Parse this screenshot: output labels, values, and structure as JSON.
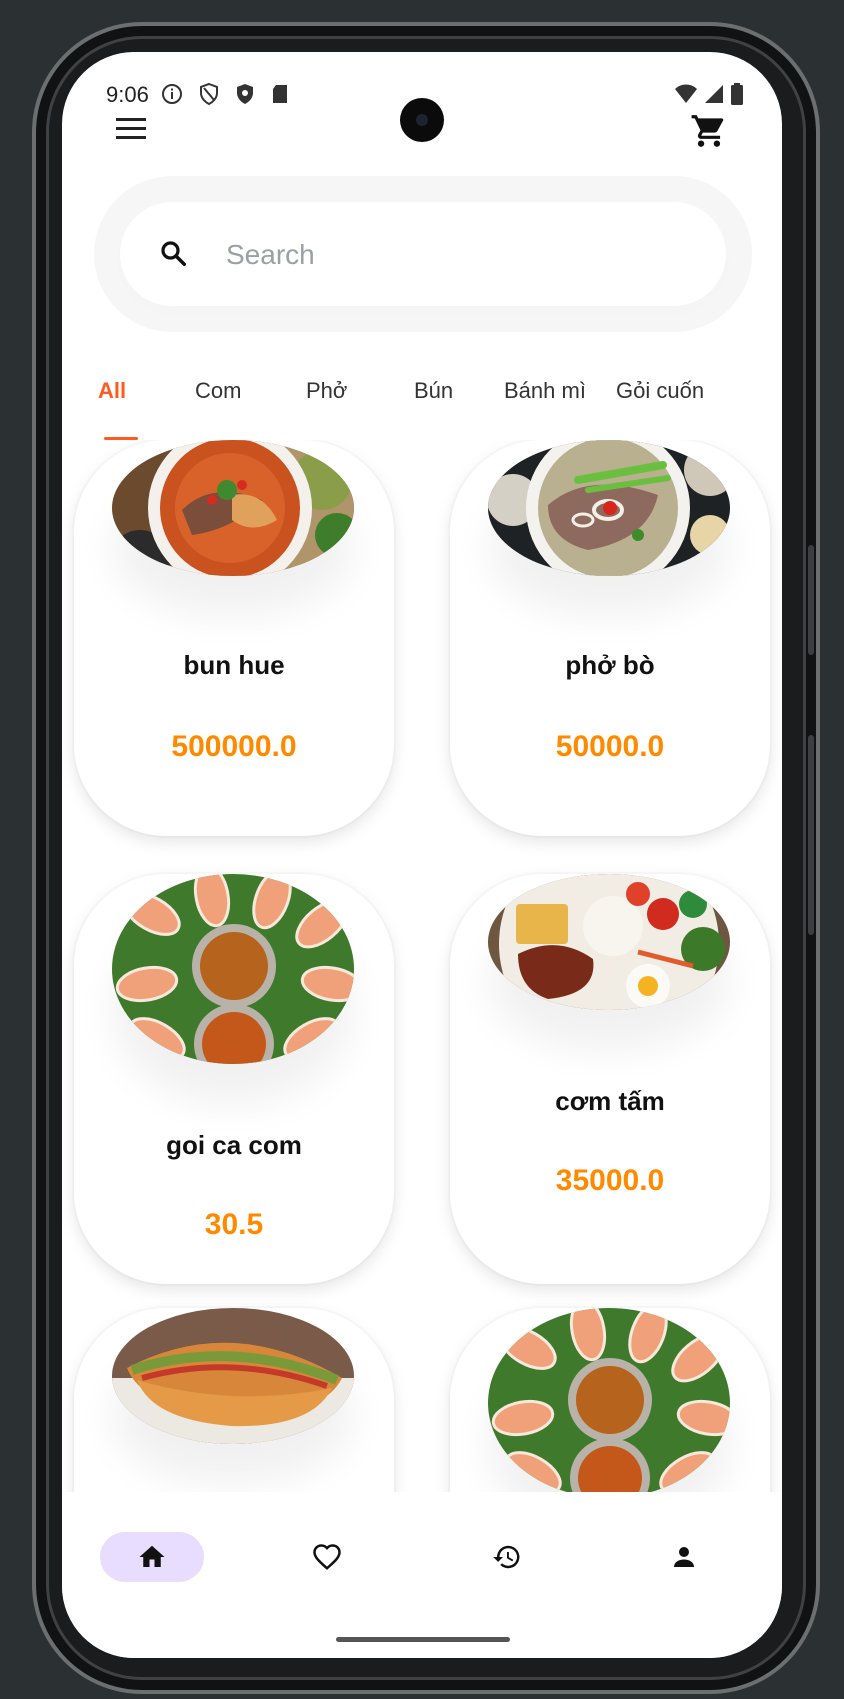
{
  "status_bar": {
    "time": "9:06"
  },
  "header": {
    "menu_icon": "menu-icon",
    "cart_icon": "cart-icon"
  },
  "search": {
    "placeholder": "Search",
    "icon": "search-icon"
  },
  "tabs": [
    {
      "label": "All",
      "active": true
    },
    {
      "label": "Com",
      "active": false
    },
    {
      "label": "Phở",
      "active": false
    },
    {
      "label": "Bún",
      "active": false
    },
    {
      "label": "Bánh mì",
      "active": false
    },
    {
      "label": "Gỏi cuốn",
      "active": false
    }
  ],
  "products": [
    {
      "name": "bun hue",
      "price": "500000.0",
      "image": "bun-hue-image"
    },
    {
      "name": "phở bò",
      "price": "50000.0",
      "image": "pho-bo-image"
    },
    {
      "name": "goi ca com",
      "price": "30.5",
      "image": "goi-cuon-image"
    },
    {
      "name": "cơm tấm",
      "price": "35000.0",
      "image": "com-tam-image"
    },
    {
      "name": "",
      "price": "",
      "image": "banh-mi-image"
    },
    {
      "name": "",
      "price": "",
      "image": "goi-cuon-image"
    }
  ],
  "bottom_nav": [
    {
      "icon": "home-icon",
      "active": true
    },
    {
      "icon": "heart-icon",
      "active": false
    },
    {
      "icon": "history-icon",
      "active": false
    },
    {
      "icon": "person-icon",
      "active": false
    }
  ],
  "colors": {
    "accent": "#ff5a1f",
    "price": "#ff8a00",
    "nav_active": "#e9ddff"
  }
}
